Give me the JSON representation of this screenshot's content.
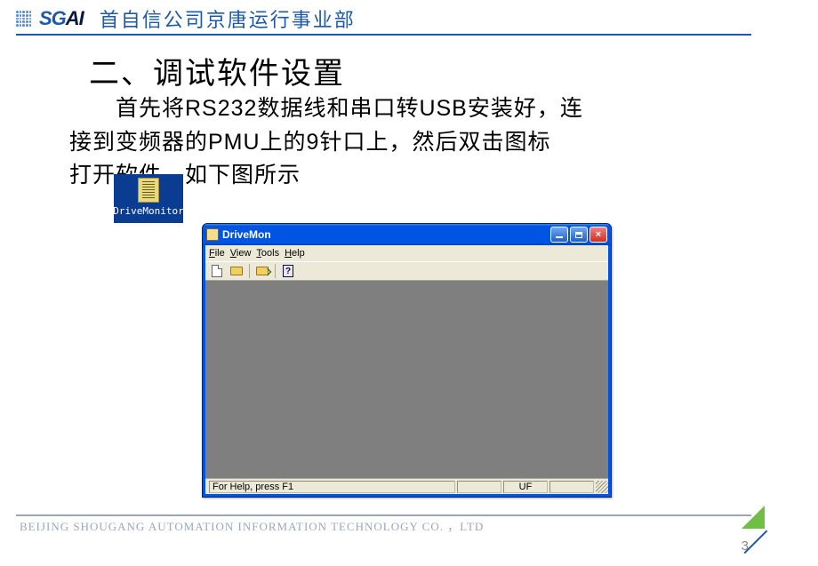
{
  "header": {
    "logo_text_1": "SG",
    "logo_text_2": "AI",
    "title": "首自信公司京唐运行事业部"
  },
  "body": {
    "heading": "二、调试软件设置",
    "paragraph": "　　首先将RS232数据线和串口转USB安装好，连接到变频器的PMU上的9针口上，然后双击图标　　　打开软件，如下图所示"
  },
  "desktop_icon": {
    "label": "DriveMonitor"
  },
  "app": {
    "title": "DriveMon",
    "menu": {
      "file": "File",
      "view": "View",
      "tools": "Tools",
      "help": "Help"
    },
    "status_text": "For Help, press F1",
    "status_cell": "UF",
    "help_glyph": "?"
  },
  "footer": {
    "text": "BEIJING SHOUGANG AUTOMATION INFORMATION TECHNOLOGY CO.  ，LTD",
    "page": "3"
  }
}
